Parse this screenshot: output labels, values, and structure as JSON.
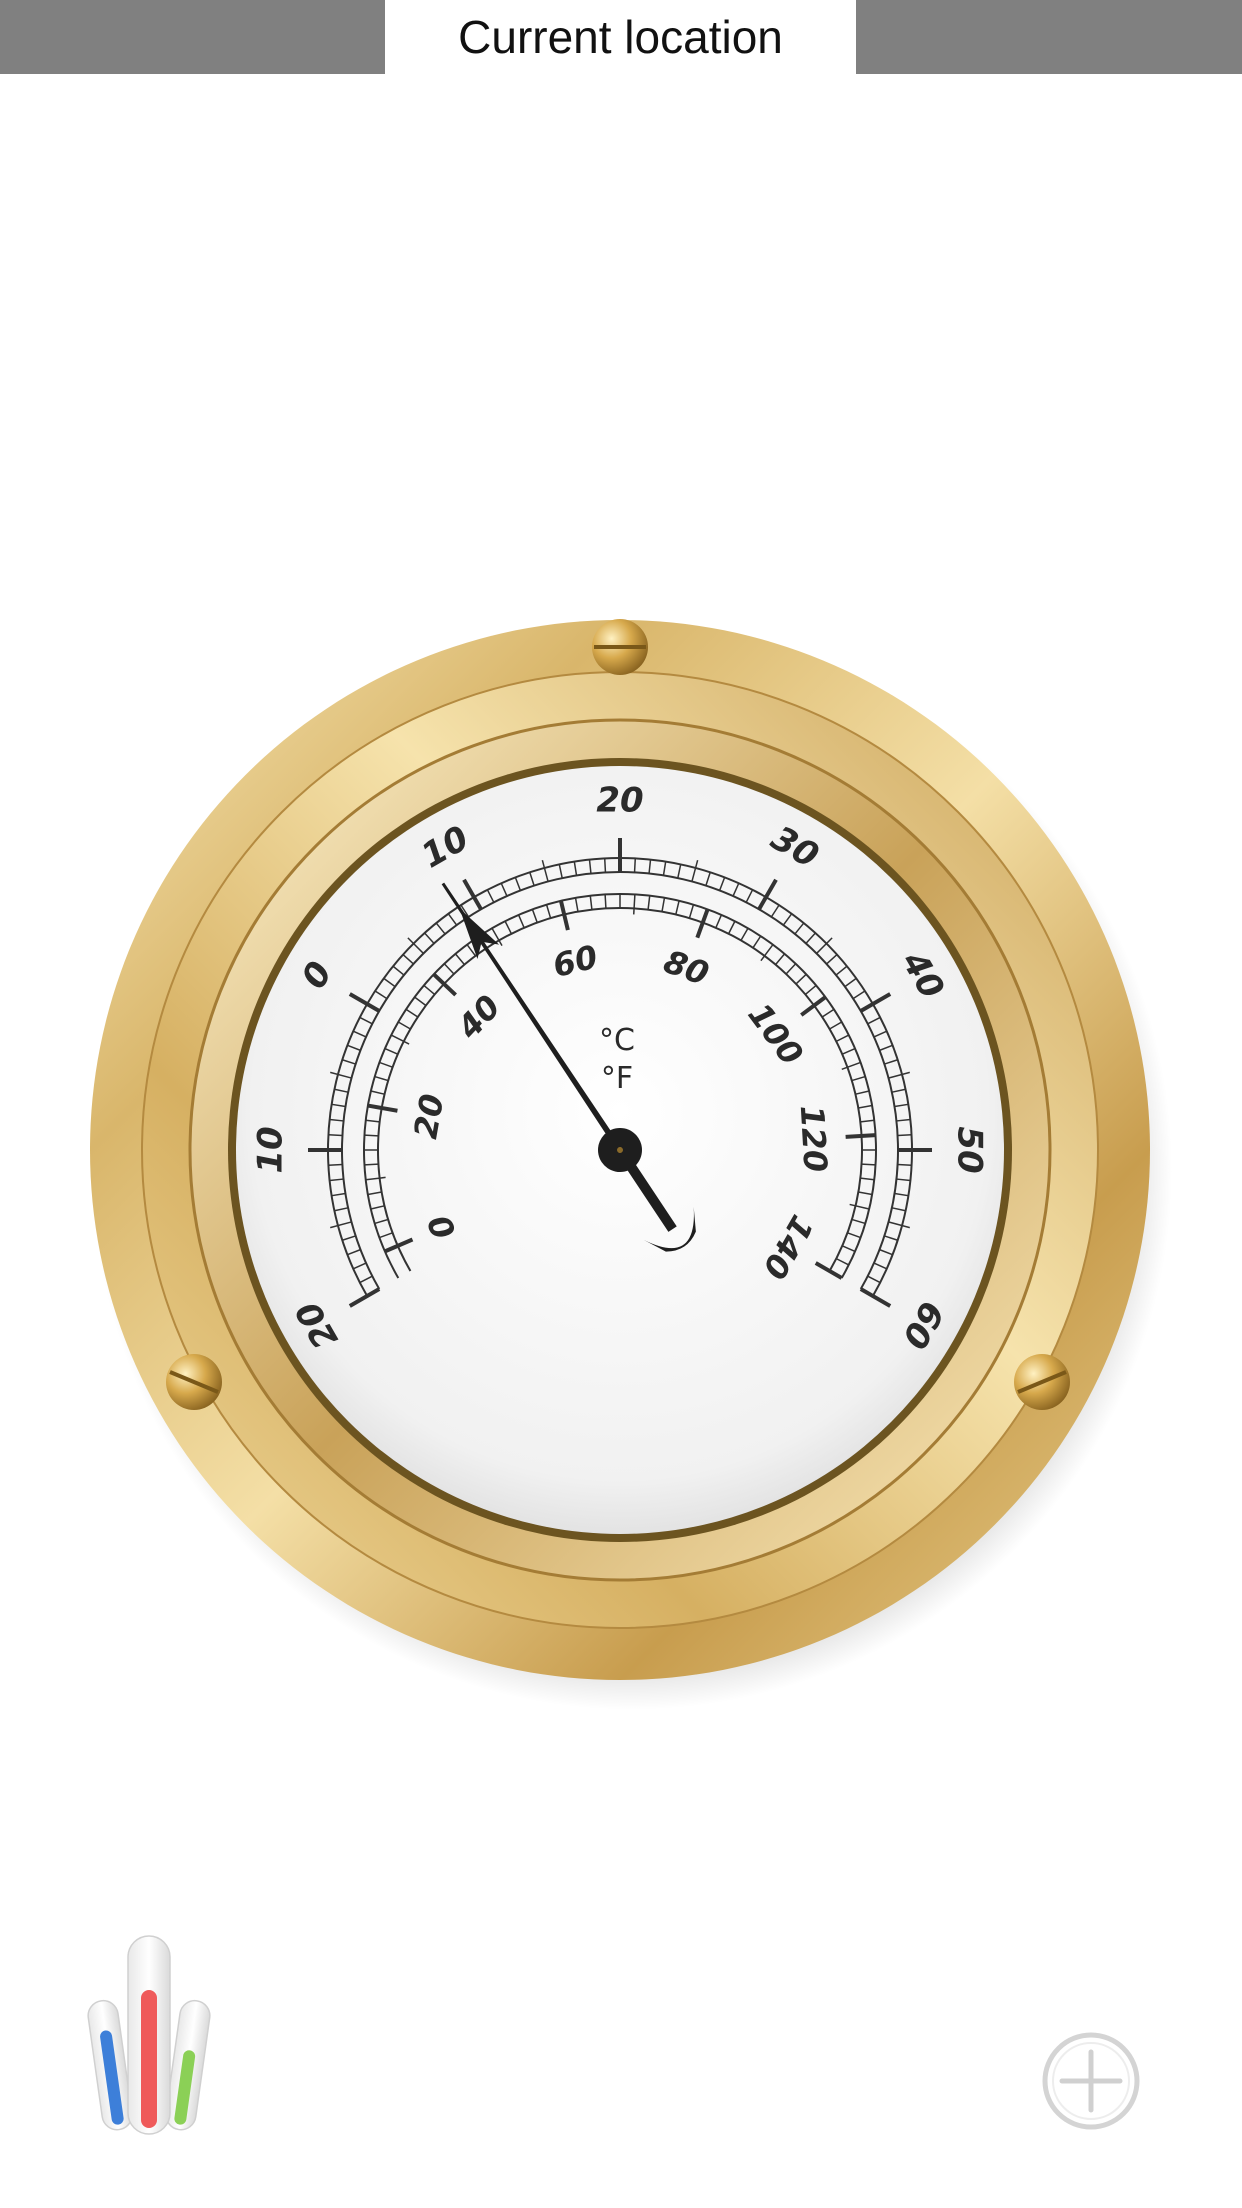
{
  "header": {
    "location_label": "Current location"
  },
  "gauge": {
    "unit_celsius": "°C",
    "unit_fahrenheit": "°F",
    "celsius_labels": [
      "20",
      "10",
      "0",
      "10",
      "20",
      "30",
      "40",
      "50",
      "60"
    ],
    "fahrenheit_labels": [
      "0",
      "20",
      "40",
      "60",
      "80",
      "100",
      "120",
      "140"
    ],
    "reading_celsius": 9,
    "reading_fraction": 0.36
  },
  "toolbar": {
    "apps_icon": "thermometers-icon",
    "add_icon": "plus-circle-icon"
  },
  "colors": {
    "top_bar": "#808080",
    "brass": "#d8b66a",
    "dial_face": "#f3f3f3",
    "needle": "#1e1e1e"
  }
}
